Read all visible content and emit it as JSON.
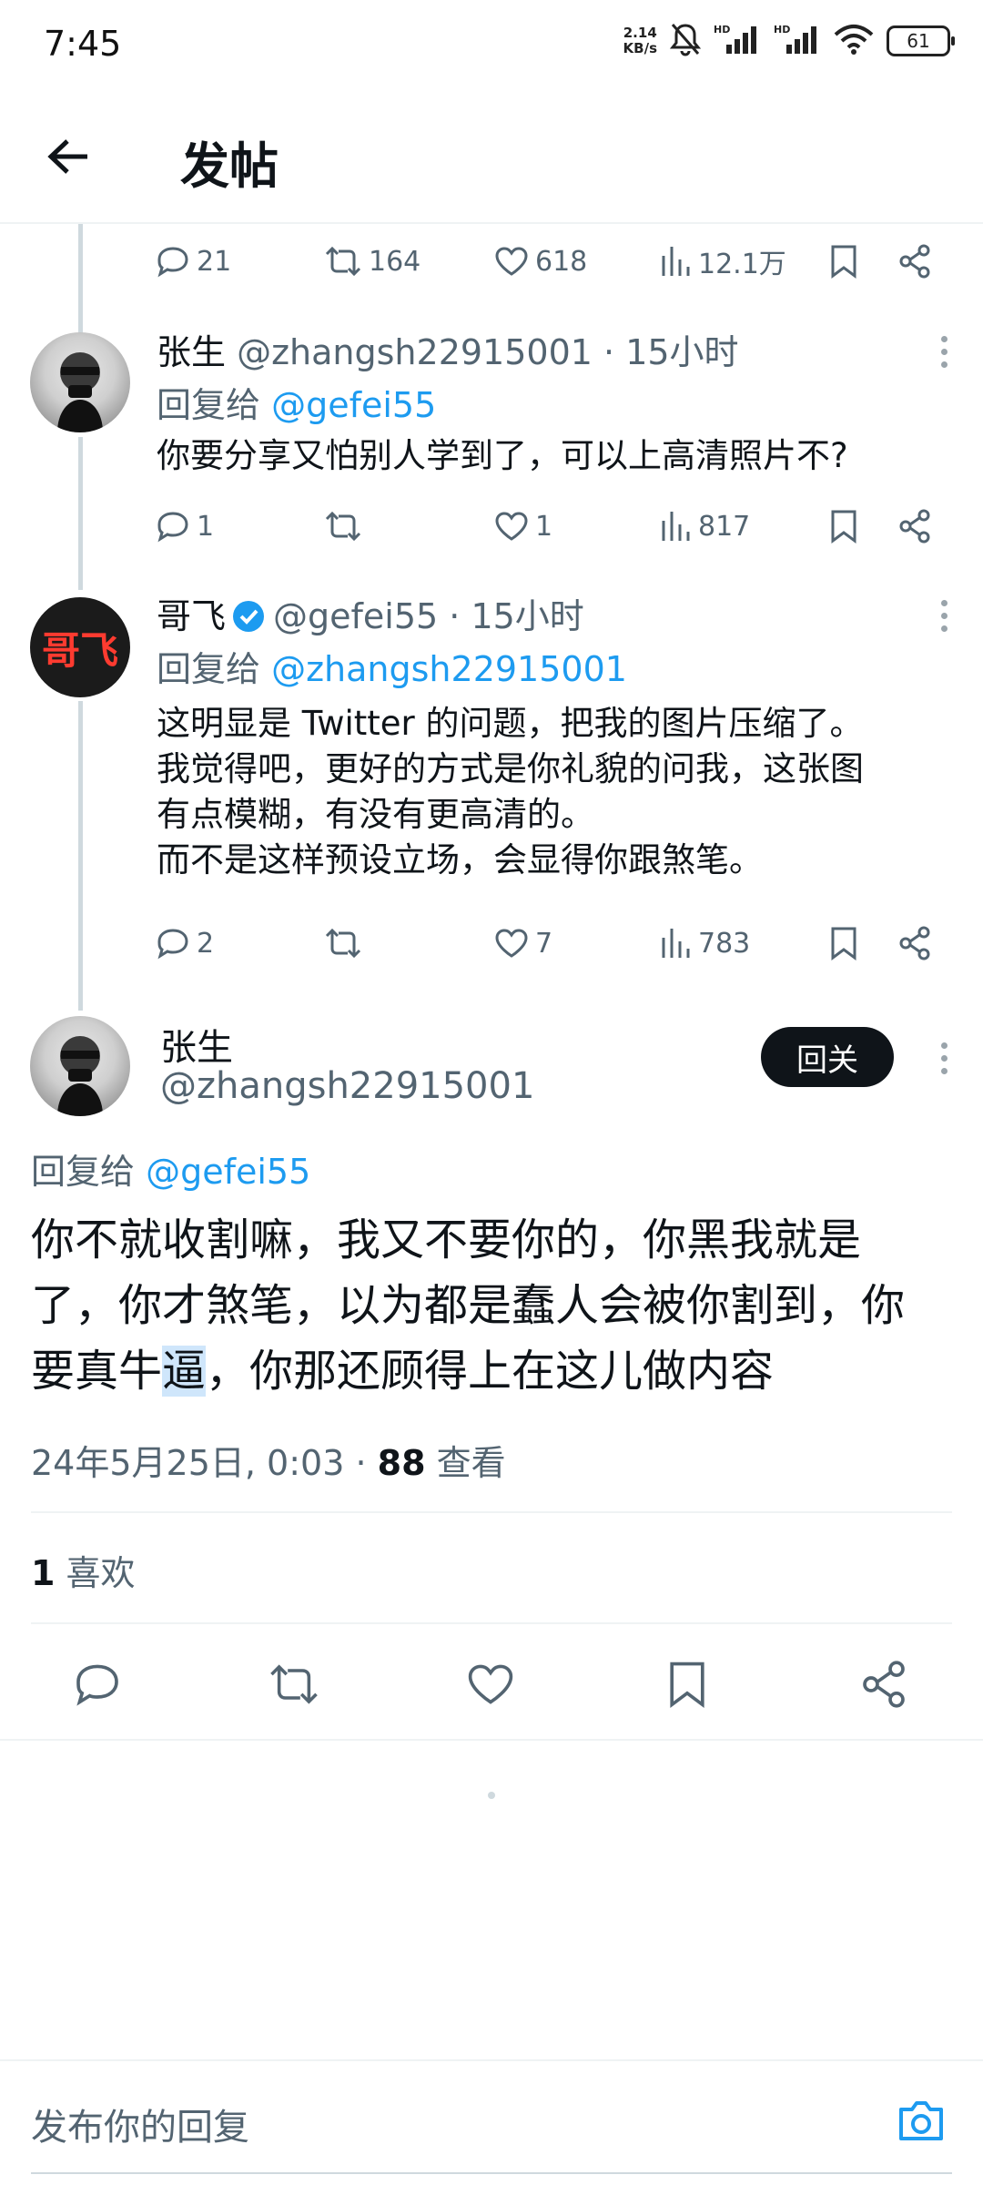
{
  "status_bar": {
    "time": "7:45",
    "net_speed_value": "2.14",
    "net_speed_unit": "KB/s",
    "battery": "61",
    "signal_label_1": "HD",
    "signal_label_2": "HD"
  },
  "header": {
    "title": "发帖"
  },
  "top_tweet_actions": {
    "replies": "21",
    "retweets": "164",
    "likes": "618",
    "views": "12.1万"
  },
  "tweets": [
    {
      "name": "张生",
      "handle": "@zhangsh22915001",
      "time": "· 15小时",
      "reply_prefix": "回复给",
      "reply_to": "@gefei55",
      "text": "你要分享又怕别人学到了，可以上高清照片不?",
      "replies": "1",
      "retweets": "",
      "likes": "1",
      "views": "817"
    },
    {
      "name": "哥飞",
      "avatar_text": "哥飞",
      "handle": "@gefei55",
      "time": "· 15小时",
      "reply_prefix": "回复给",
      "reply_to": "@zhangsh22915001",
      "text_lines": [
        "这明显是 Twitter 的问题，把我的图片压缩了。",
        "我觉得吧，更好的方式是你礼貌的问我，这张图",
        "有点模糊，有没有更高清的。",
        "而不是这样预设立场，会显得你跟煞笔。"
      ],
      "replies": "2",
      "retweets": "",
      "likes": "7",
      "views": "783"
    }
  ],
  "main_tweet": {
    "name": "张生",
    "handle": "@zhangsh22915001",
    "follow_label": "回关",
    "reply_prefix": "回复给",
    "reply_to": "@gefei55",
    "text_lines": [
      "你不就收割嘛，我又不要你的，你黑我就是",
      "了，你才煞笔，以为都是蠢人会被你割到，你"
    ],
    "text_line3_before": "要真牛",
    "text_line3_highlight": "逼",
    "text_line3_after": "，你那还顾得上在这儿做内容",
    "timestamp": "24年5月25日, 0:03 ·",
    "view_count": "88",
    "view_label": "查看",
    "like_count": "1",
    "like_label": "喜欢"
  },
  "reply_box": {
    "placeholder": "发布你的回复"
  },
  "colors": {
    "accent": "#1d9bf0",
    "secondary_text": "#536471",
    "primary_text": "#0f1419"
  }
}
